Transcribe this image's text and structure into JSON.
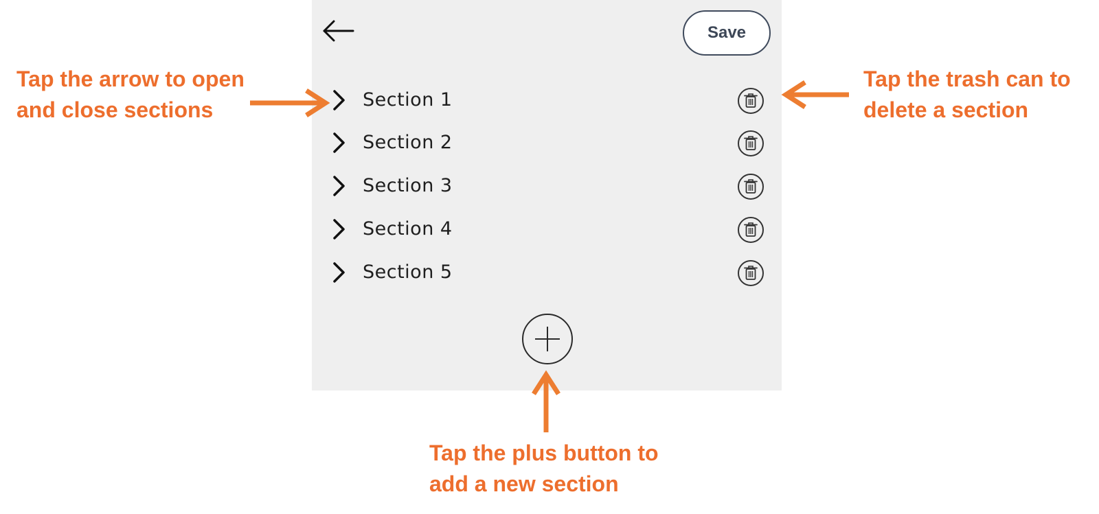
{
  "toolbar": {
    "back_icon": "arrow-left-icon",
    "save_label": "Save"
  },
  "sections": [
    {
      "label": "Section 1"
    },
    {
      "label": "Section 2"
    },
    {
      "label": "Section 3"
    },
    {
      "label": "Section 4"
    },
    {
      "label": "Section 5"
    }
  ],
  "icons": {
    "expand": "chevron-right-icon",
    "delete": "trash-icon",
    "add": "plus-icon"
  },
  "annotations": {
    "arrow_hint": {
      "line1": "Tap the arrow to open",
      "line2": "and close sections"
    },
    "trash_hint": {
      "line1": "Tap the trash can to",
      "line2": "delete a section"
    },
    "plus_hint": {
      "line1": "Tap the plus button to",
      "line2": "add a new section"
    }
  },
  "colors": {
    "annotation": "#ed6e2d",
    "panel_background": "#efefef",
    "save_border": "#3f4a5c"
  }
}
